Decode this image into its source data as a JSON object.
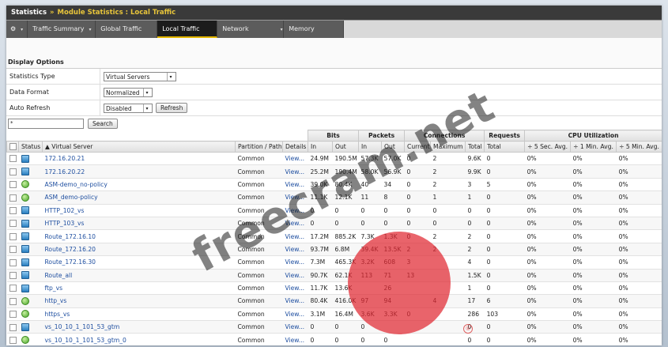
{
  "breadcrumb": {
    "root": "Statistics",
    "separator": "»",
    "page": "Module Statistics : Local Traffic"
  },
  "tabs": [
    {
      "label": "Traffic Summary",
      "dropdown": true
    },
    {
      "label": "Global Traffic",
      "dropdown": false
    },
    {
      "label": "Local Traffic",
      "dropdown": false,
      "active": true
    },
    {
      "label": "Network",
      "dropdown": true
    },
    {
      "label": "Memory",
      "dropdown": false
    }
  ],
  "display_options": {
    "title": "Display Options",
    "statistics_type_label": "Statistics Type",
    "statistics_type_value": "Virtual Servers",
    "data_format_label": "Data Format",
    "data_format_value": "Normalized",
    "auto_refresh_label": "Auto Refresh",
    "auto_refresh_value": "Disabled",
    "refresh_button": "Refresh"
  },
  "search": {
    "value": "*",
    "button": "Search"
  },
  "groups": {
    "bits": "Bits",
    "packets": "Packets",
    "connections": "Connections",
    "requests": "Requests",
    "cpu": "CPU Utilization"
  },
  "columns": {
    "status": "Status",
    "name": "▲ Virtual Server",
    "partition": "Partition / Path",
    "details": "Details",
    "bits_in": "In",
    "bits_out": "Out",
    "pkts_in": "In",
    "pkts_out": "Out",
    "conn_current": "Current",
    "conn_maximum": "Maximum",
    "conn_total": "Total",
    "req_total": "Total",
    "cpu_5s": "÷ 5 Sec. Avg.",
    "cpu_1m": "÷ 1 Min. Avg.",
    "cpu_5m": "÷ 5 Min. Avg."
  },
  "rows": [
    {
      "status": "blue",
      "name": "172.16.20.21",
      "partition": "Common",
      "details": "View...",
      "bits_in": "24.9M",
      "bits_out": "190.5M",
      "pkts_in": "57.3K",
      "pkts_out": "57.0K",
      "cur": "0",
      "max": "2",
      "total": "9.6K",
      "req": "0",
      "cpu5s": "0%",
      "cpu1m": "0%",
      "cpu5m": "0%"
    },
    {
      "status": "blue",
      "name": "172.16.20.22",
      "partition": "Common",
      "details": "View...",
      "bits_in": "25.2M",
      "bits_out": "190.4M",
      "pkts_in": "58.0K",
      "pkts_out": "56.9K",
      "cur": "0",
      "max": "2",
      "total": "9.9K",
      "req": "0",
      "cpu5s": "0%",
      "cpu1m": "0%",
      "cpu5m": "0%"
    },
    {
      "status": "green",
      "name": "ASM-demo_no-policy",
      "partition": "Common",
      "details": "View...",
      "bits_in": "39.0K",
      "bits_out": "80.4K",
      "pkts_in": "40",
      "pkts_out": "34",
      "cur": "0",
      "max": "2",
      "total": "3",
      "req": "5",
      "cpu5s": "0%",
      "cpu1m": "0%",
      "cpu5m": "0%"
    },
    {
      "status": "green",
      "name": "ASM_demo-policy",
      "partition": "Common",
      "details": "View...",
      "bits_in": "11.1K",
      "bits_out": "12.1K",
      "pkts_in": "11",
      "pkts_out": "8",
      "cur": "0",
      "max": "1",
      "total": "1",
      "req": "0",
      "cpu5s": "0%",
      "cpu1m": "0%",
      "cpu5m": "0%"
    },
    {
      "status": "blue",
      "name": "HTTP_102_vs",
      "partition": "Common",
      "details": "View...",
      "bits_in": "0",
      "bits_out": "0",
      "pkts_in": "0",
      "pkts_out": "0",
      "cur": "0",
      "max": "0",
      "total": "0",
      "req": "0",
      "cpu5s": "0%",
      "cpu1m": "0%",
      "cpu5m": "0%"
    },
    {
      "status": "blue",
      "name": "HTTP_103_vs",
      "partition": "Common",
      "details": "View...",
      "bits_in": "0",
      "bits_out": "0",
      "pkts_in": "0",
      "pkts_out": "0",
      "cur": "0",
      "max": "0",
      "total": "0",
      "req": "0",
      "cpu5s": "0%",
      "cpu1m": "0%",
      "cpu5m": "0%"
    },
    {
      "status": "blue",
      "name": "Route_172.16.10",
      "partition": "Common",
      "details": "View...",
      "bits_in": "17.2M",
      "bits_out": "885.2K",
      "pkts_in": "7.3K",
      "pkts_out": "1.3K",
      "cur": "0",
      "max": "2",
      "total": "2",
      "req": "0",
      "cpu5s": "0%",
      "cpu1m": "0%",
      "cpu5m": "0%"
    },
    {
      "status": "blue",
      "name": "Route_172.16.20",
      "partition": "Common",
      "details": "View...",
      "bits_in": "93.7M",
      "bits_out": "6.8M",
      "pkts_in": "39.4K",
      "pkts_out": "13.5K",
      "cur": "2",
      "max": "2",
      "total": "2",
      "req": "0",
      "cpu5s": "0%",
      "cpu1m": "0%",
      "cpu5m": "0%"
    },
    {
      "status": "blue",
      "name": "Route_172.16.30",
      "partition": "Common",
      "details": "View...",
      "bits_in": "7.3M",
      "bits_out": "465.3K",
      "pkts_in": "3.2K",
      "pkts_out": "608",
      "cur": "3",
      "max": "",
      "total": "4",
      "req": "0",
      "cpu5s": "0%",
      "cpu1m": "0%",
      "cpu5m": "0%"
    },
    {
      "status": "blue",
      "name": "Route_all",
      "partition": "Common",
      "details": "View...",
      "bits_in": "90.7K",
      "bits_out": "62.1K",
      "pkts_in": "113",
      "pkts_out": "71",
      "cur": "13",
      "max": "",
      "total": "1.5K",
      "req": "0",
      "cpu5s": "0%",
      "cpu1m": "0%",
      "cpu5m": "0%"
    },
    {
      "status": "blue",
      "name": "ftp_vs",
      "partition": "Common",
      "details": "View...",
      "bits_in": "11.7K",
      "bits_out": "13.6K",
      "pkts_in": "",
      "pkts_out": "26",
      "cur": "",
      "max": "",
      "total": "1",
      "req": "0",
      "cpu5s": "0%",
      "cpu1m": "0%",
      "cpu5m": "0%"
    },
    {
      "status": "green",
      "name": "http_vs",
      "partition": "Common",
      "details": "View...",
      "bits_in": "80.4K",
      "bits_out": "416.0K",
      "pkts_in": "97",
      "pkts_out": "94",
      "cur": "",
      "max": "4",
      "total": "17",
      "req": "6",
      "cpu5s": "0%",
      "cpu1m": "0%",
      "cpu5m": "0%"
    },
    {
      "status": "green",
      "name": "https_vs",
      "partition": "Common",
      "details": "View...",
      "bits_in": "3.1M",
      "bits_out": "16.4M",
      "pkts_in": "3.6K",
      "pkts_out": "3.3K",
      "cur": "0",
      "max": "",
      "total": "286",
      "req": "103",
      "cpu5s": "0%",
      "cpu1m": "0%",
      "cpu5m": "0%"
    },
    {
      "status": "blue",
      "name": "vs_10_10_1_101_53_gtm",
      "partition": "Common",
      "details": "View...",
      "bits_in": "0",
      "bits_out": "0",
      "pkts_in": "0",
      "pkts_out": "",
      "cur": "",
      "max": "",
      "total": "0",
      "req": "0",
      "cpu5s": "0%",
      "cpu1m": "0%",
      "cpu5m": "0%"
    },
    {
      "status": "green",
      "name": "vs_10_10_1_101_53_gtm_0",
      "partition": "Common",
      "details": "View...",
      "bits_in": "0",
      "bits_out": "0",
      "pkts_in": "0",
      "pkts_out": "0",
      "cur": "",
      "max": "",
      "total": "0",
      "req": "0",
      "cpu5s": "0%",
      "cpu1m": "0%",
      "cpu5m": "0%"
    }
  ],
  "overlay": {
    "watermark": "freecram.net",
    "logo_reg": "®"
  }
}
